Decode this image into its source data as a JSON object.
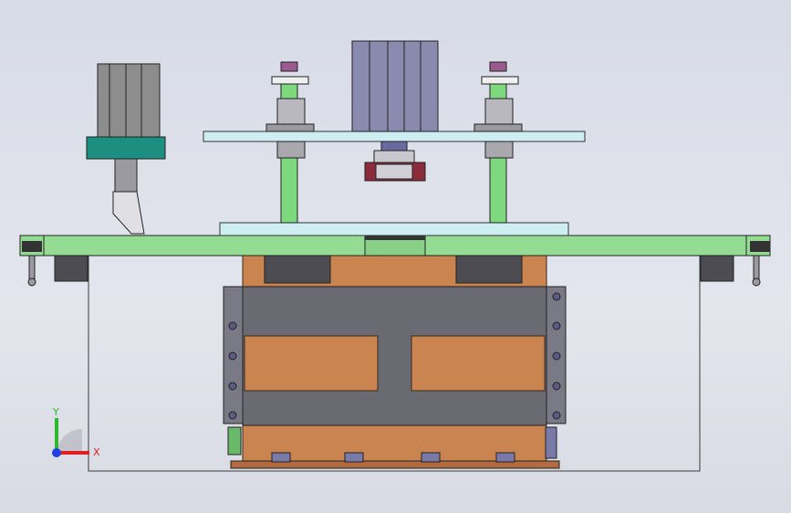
{
  "view": {
    "background_top": "#d7dbe6",
    "background_bottom": "#d9dbe4"
  },
  "colors": {
    "plate_green": "#94dc94",
    "plate_cyan": "#cfeef2",
    "rod_green": "#7ed87e",
    "cylinder_gray": "#8d8d8d",
    "motor_purple": "#8a8aae",
    "copper": "#c98450",
    "frame_gray": "#6a6a72",
    "teal_block": "#1c8f80",
    "maroon": "#8a2c3c",
    "outline": "#2a2a2a"
  },
  "triad": {
    "y_label": "Y",
    "x_label": "X",
    "y_color": "#2db82d",
    "x_color": "#e02020",
    "z_color": "#2040e0"
  }
}
